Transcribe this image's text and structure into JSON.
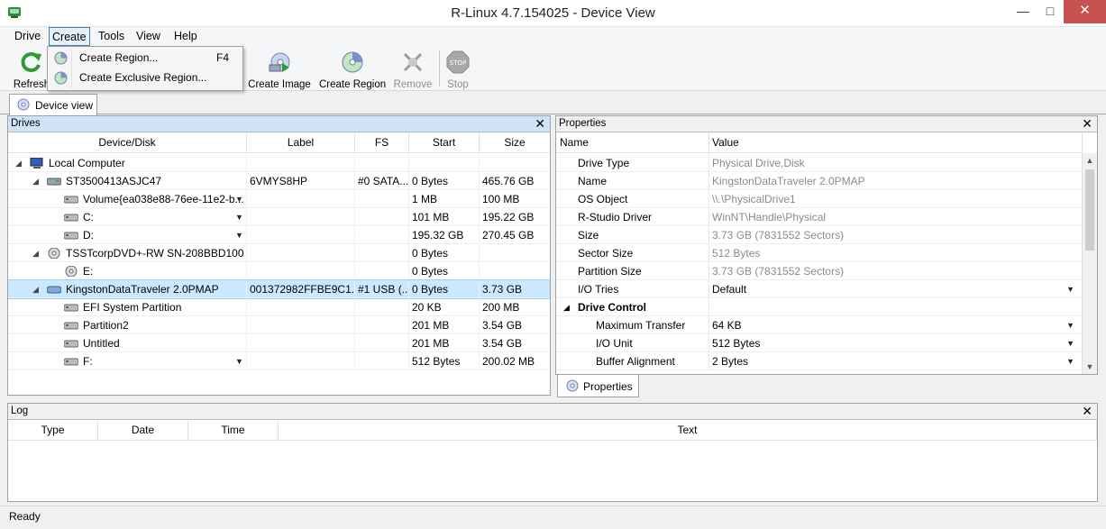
{
  "window": {
    "title": "R-Linux 4.7.154025 - Device View"
  },
  "menu": {
    "drive": "Drive",
    "create": "Create",
    "tools": "Tools",
    "view": "View",
    "help": "Help"
  },
  "create_menu": {
    "create_region": "Create Region...",
    "create_region_key": "F4",
    "create_exclusive_region": "Create Exclusive Region..."
  },
  "toolbar": {
    "refresh": "Refresh",
    "create_image": "Create Image",
    "create_region": "Create Region",
    "remove": "Remove",
    "stop": "Stop"
  },
  "tabs": {
    "device_view": "Device view"
  },
  "drives_panel": {
    "title": "Drives",
    "columns": {
      "device": "Device/Disk",
      "label": "Label",
      "fs": "FS",
      "start": "Start",
      "size": "Size"
    },
    "rows": [
      {
        "name": "Local Computer",
        "label": "",
        "fs": "",
        "start": "",
        "size": ""
      },
      {
        "name": "ST3500413ASJC47",
        "label": "6VMYS8HP",
        "fs": "#0 SATA...",
        "start": "0 Bytes",
        "size": "465.76 GB"
      },
      {
        "name": "Volume{ea038e88-76ee-11e2-b...",
        "label": "",
        "fs": "",
        "start": "1 MB",
        "size": "100 MB"
      },
      {
        "name": "C:",
        "label": "",
        "fs": "",
        "start": "101 MB",
        "size": "195.22 GB"
      },
      {
        "name": "D:",
        "label": "",
        "fs": "",
        "start": "195.32 GB",
        "size": "270.45 GB"
      },
      {
        "name": "TSSTcorpDVD+-RW SN-208BBD100",
        "label": "",
        "fs": "",
        "start": "0 Bytes",
        "size": ""
      },
      {
        "name": "E:",
        "label": "",
        "fs": "",
        "start": "0 Bytes",
        "size": ""
      },
      {
        "name": "KingstonDataTraveler 2.0PMAP",
        "label": "001372982FFBE9C1...",
        "fs": "#1 USB (...",
        "start": "0 Bytes",
        "size": "3.73 GB"
      },
      {
        "name": "EFI System Partition",
        "label": "",
        "fs": "",
        "start": "20 KB",
        "size": "200 MB"
      },
      {
        "name": "Partition2",
        "label": "",
        "fs": "",
        "start": "201 MB",
        "size": "3.54 GB"
      },
      {
        "name": "Untitled",
        "label": "",
        "fs": "",
        "start": "201 MB",
        "size": "3.54 GB"
      },
      {
        "name": "F:",
        "label": "",
        "fs": "",
        "start": "512 Bytes",
        "size": "200.02 MB"
      }
    ]
  },
  "properties_panel": {
    "title": "Properties",
    "columns": {
      "name": "Name",
      "value": "Value"
    },
    "rows": [
      {
        "name": "Drive Type",
        "value": "Physical Drive,Disk"
      },
      {
        "name": "Name",
        "value": "KingstonDataTraveler 2.0PMAP"
      },
      {
        "name": "OS Object",
        "value": "\\\\.\\PhysicalDrive1"
      },
      {
        "name": "R-Studio Driver",
        "value": "WinNT\\Handle\\Physical"
      },
      {
        "name": "Size",
        "value": "3.73 GB (7831552 Sectors)"
      },
      {
        "name": "Sector Size",
        "value": "512 Bytes"
      },
      {
        "name": "Partition Size",
        "value": "3.73 GB (7831552 Sectors)"
      },
      {
        "name": "I/O Tries",
        "value": "Default"
      },
      {
        "name": "Drive Control",
        "value": ""
      },
      {
        "name": "Maximum Transfer",
        "value": "64 KB"
      },
      {
        "name": "I/O Unit",
        "value": "512 Bytes"
      },
      {
        "name": "Buffer Alignment",
        "value": "2 Bytes"
      }
    ],
    "tab": "Properties"
  },
  "log_panel": {
    "title": "Log",
    "columns": {
      "type": "Type",
      "date": "Date",
      "time": "Time",
      "text": "Text"
    }
  },
  "status": {
    "text": "Ready"
  },
  "colors": {
    "active_header": "#cfe4f9",
    "selection": "#cce8ff",
    "close_button": "#c75050"
  }
}
